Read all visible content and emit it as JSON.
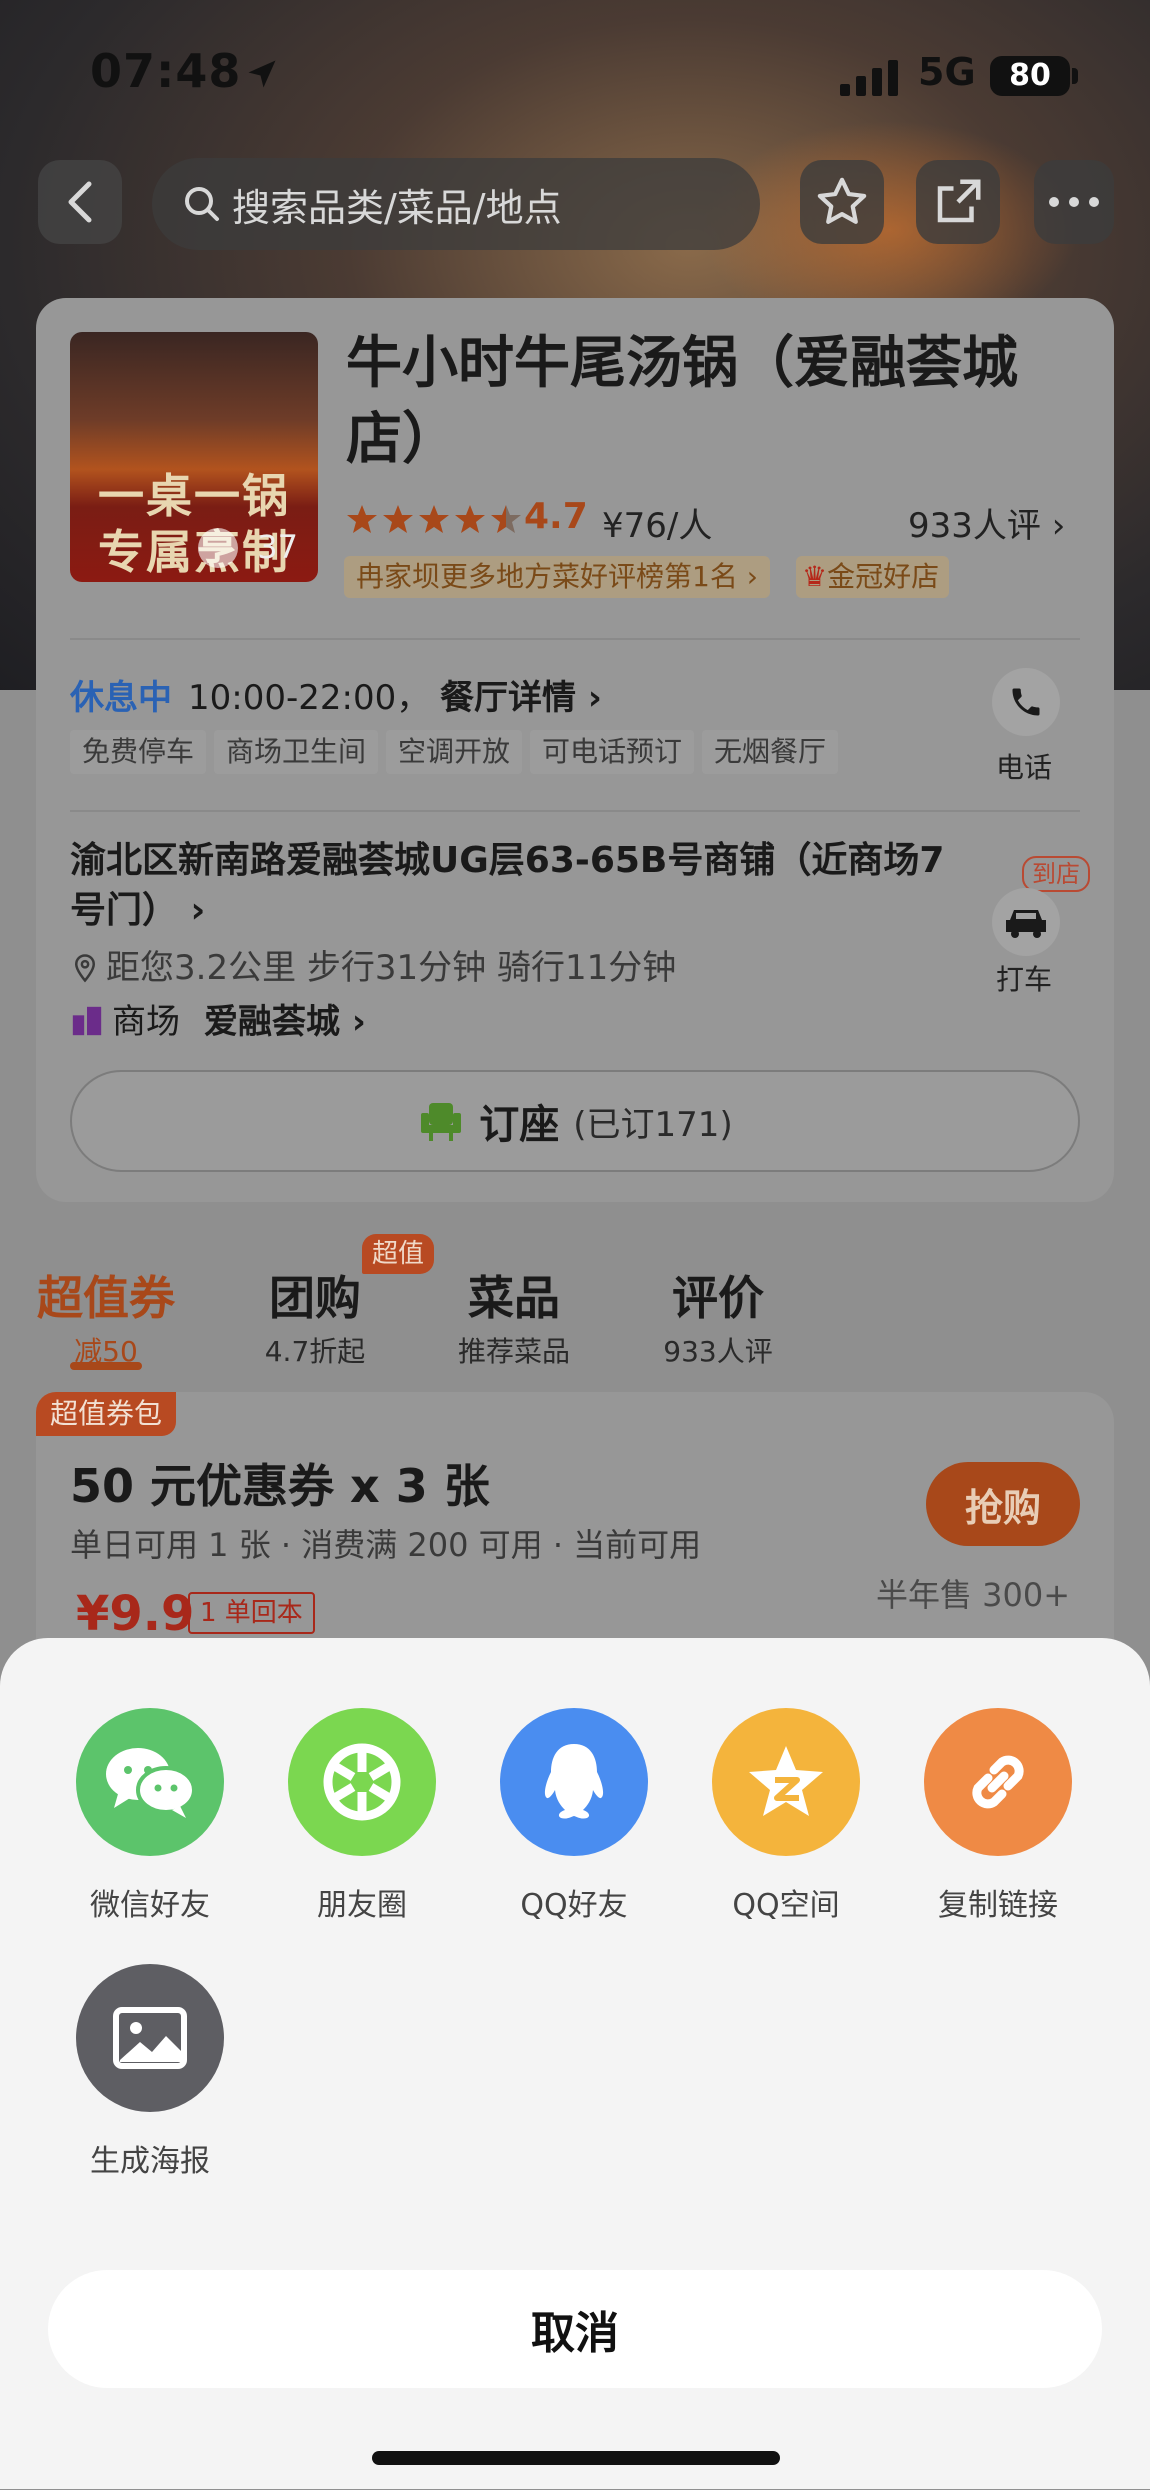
{
  "status_bar": {
    "time": "07:48",
    "network": "5G",
    "battery": "80"
  },
  "nav": {
    "search_placeholder": "搜索品类/菜品/地点",
    "icons": [
      "back-icon",
      "search-icon",
      "star-icon",
      "share-icon",
      "more-icon"
    ]
  },
  "shop": {
    "name": "牛小时牛尾汤锅（爱融荟城店）",
    "thumb_lines": [
      "一桌一锅",
      "专属烹制"
    ],
    "photo_count": "37",
    "rating": 4.7,
    "rating_text": "4.7",
    "price": "¥76/人",
    "reviews": "933人评",
    "rank_tag": "冉家坝更多地方菜好评榜第1名",
    "crown_tag": "金冠好店",
    "status": "休息中",
    "hours": "10:00-22:00，",
    "detail_link": "餐厅详情",
    "facilities": [
      "免费停车",
      "商场卫生间",
      "空调开放",
      "可电话预订",
      "无烟餐厅"
    ],
    "phone_label": "电话",
    "address": "渝北区新南路爱融荟城UG层63-65B号商铺（近商场7号门）",
    "distance": "距您3.2公里 步行31分钟 骑行11分钟",
    "mall_label": "商场",
    "mall_name": "爱融荟城",
    "arrive_tag": "到店",
    "taxi_label": "打车",
    "book_label": "订座",
    "book_count": "(已订171)"
  },
  "tabs": [
    {
      "title": "超值券",
      "sub": "减50",
      "active": true
    },
    {
      "title": "团购",
      "sub": "4.7折起",
      "badge": "超值"
    },
    {
      "title": "菜品",
      "sub": "推荐菜品"
    },
    {
      "title": "评价",
      "sub": "933人评"
    }
  ],
  "coupon": {
    "badge": "超值券包",
    "title": "50 元优惠券 x 3 张",
    "rules": "单日可用 1 张 · 消费满 200 可用 · 当前可用",
    "price": "¥9.9",
    "note": "1 单回本",
    "button": "抢购",
    "sold": "半年售 300+"
  },
  "share_sheet": {
    "items": [
      {
        "label": "微信好友",
        "icon": "wechat-icon",
        "color": "#5cc46b"
      },
      {
        "label": "朋友圈",
        "icon": "moments-icon",
        "color": "#7bd750"
      },
      {
        "label": "QQ好友",
        "icon": "qq-icon",
        "color": "#4a8df0"
      },
      {
        "label": "QQ空间",
        "icon": "qzone-icon",
        "color": "#f4b43c"
      },
      {
        "label": "复制链接",
        "icon": "link-icon",
        "color": "#ef8a45"
      },
      {
        "label": "生成海报",
        "icon": "poster-icon",
        "color": "#5e5e63"
      }
    ],
    "cancel": "取消"
  }
}
